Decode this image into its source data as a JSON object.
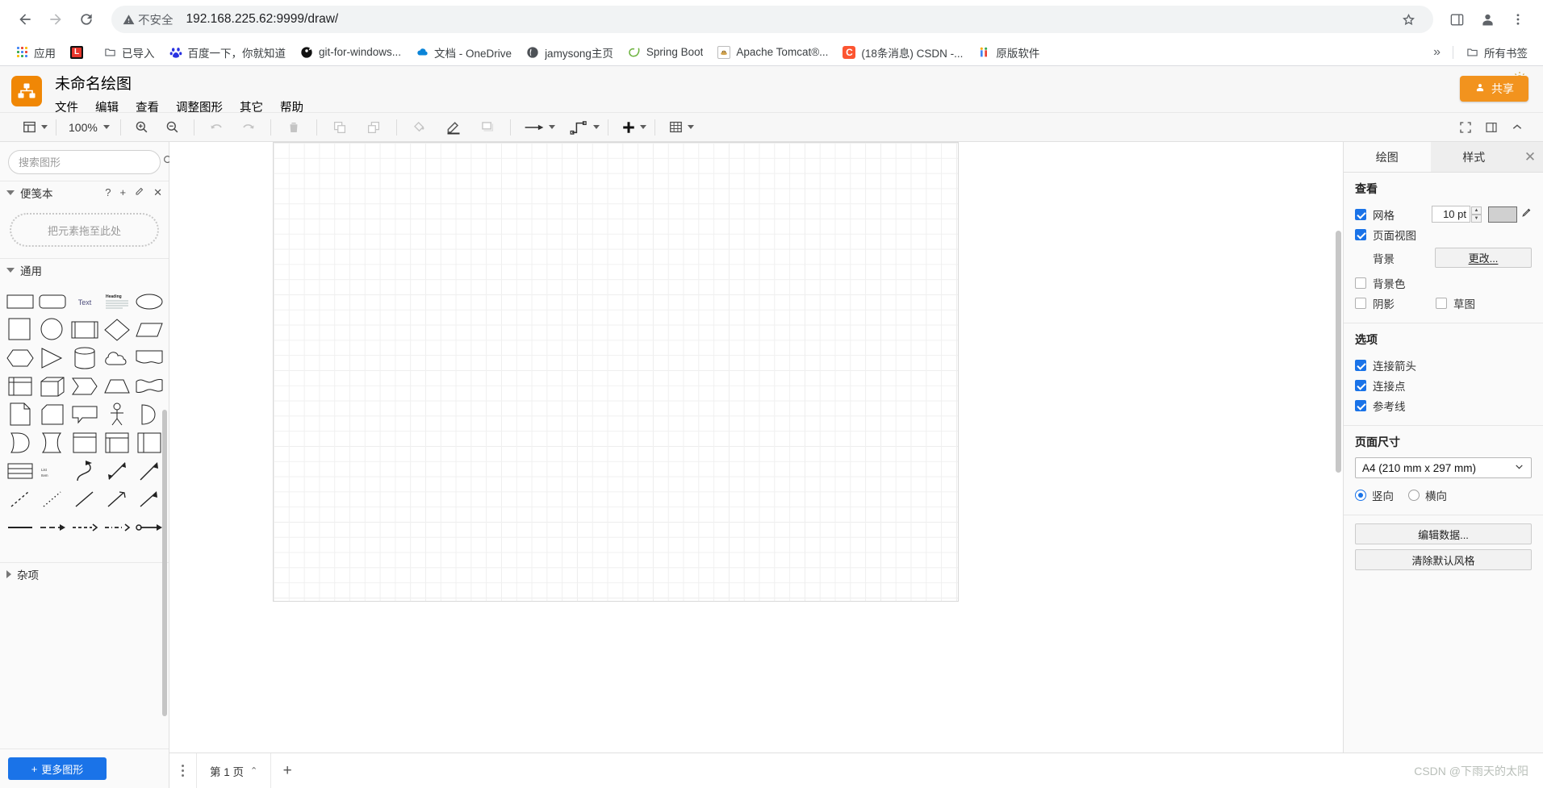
{
  "browser": {
    "back_label": "Back",
    "forward_label": "Forward",
    "reload_label": "Reload",
    "security_label": "不安全",
    "url": "192.168.225.62:9999/draw/",
    "star_label": "Bookmark",
    "sidepanel_label": "Side panel",
    "profile_label": "Profile",
    "menu_label": "Chrome menu",
    "bookmarks": [
      {
        "label": "应用",
        "icon": "apps-grid-icon",
        "color": "#4285f4"
      },
      {
        "label": "",
        "icon": "leetcode-icon",
        "color": "#ef4444"
      },
      {
        "label": "已导入",
        "icon": "folder-icon",
        "color": "#5f6368"
      },
      {
        "label": "百度一下，你就知道",
        "icon": "baidu-icon",
        "color": "#2932e1"
      },
      {
        "label": "git-for-windows...",
        "icon": "git-icon",
        "color": "#111111"
      },
      {
        "label": "文档 - OneDrive",
        "icon": "onedrive-icon",
        "color": "#0a84d8"
      },
      {
        "label": "jamysong主页",
        "icon": "globe-icon",
        "color": "#4d5156"
      },
      {
        "label": "Spring Boot",
        "icon": "spring-icon",
        "color": "#6db33f"
      },
      {
        "label": "Apache Tomcat®...",
        "icon": "tomcat-icon",
        "color": "#d1a34f"
      },
      {
        "label": "(18条消息) CSDN -...",
        "icon": "csdn-icon",
        "color": "#fc5531"
      },
      {
        "label": "原版软件",
        "icon": "people-icon",
        "color": "#f9ab00"
      }
    ],
    "overflow_label": "»",
    "all_bookmarks_label": "所有书签"
  },
  "app": {
    "logo_name": "drawio-logo",
    "title": "未命名绘图",
    "menus": [
      "文件",
      "编辑",
      "查看",
      "调整图形",
      "其它",
      "帮助"
    ],
    "share_label": "共享",
    "theme_toggle_label": "切换主题"
  },
  "toolbar": {
    "view_label": "视图",
    "zoom_value": "100%",
    "zoom_in_label": "放大",
    "zoom_out_label": "缩小",
    "undo_label": "撤销",
    "redo_label": "重做",
    "delete_label": "删除",
    "to_front_label": "置于顶层",
    "to_back_label": "置于底层",
    "fill_label": "填充颜色",
    "line_label": "线条颜色",
    "shadow_label": "阴影",
    "waypoints_label": "连线样式",
    "connection_label": "连接方式",
    "insert_label": "插入",
    "table_label": "表格",
    "fullscreen_label": "全屏",
    "format_label": "格式面板",
    "collapse_label": "折叠"
  },
  "sidebar": {
    "search": {
      "placeholder": "搜索图形",
      "value": "",
      "icon": "search-icon"
    },
    "scratchpad": {
      "title": "便笺本",
      "help_label": "?",
      "add_label": "+",
      "edit_label": "✎",
      "close_label": "✕",
      "drop_hint": "把元素拖至此处"
    },
    "general": {
      "title": "通用"
    },
    "misc": {
      "title": "杂项"
    },
    "more_shapes_label": "更多图形",
    "shapes": [
      "rectangle",
      "rounded-rectangle",
      "text",
      "textbox",
      "ellipse",
      "square",
      "circle",
      "process",
      "diamond",
      "parallelogram",
      "hexagon",
      "triangle",
      "cylinder",
      "cloud",
      "document",
      "internal-storage",
      "cube",
      "step",
      "trapezoid",
      "tape",
      "note",
      "card",
      "callout",
      "actor",
      "or",
      "and",
      "data-storage",
      "container",
      "container2",
      "vertical-container",
      "horizontal-pool",
      "list",
      "curve",
      "bidirectional-arrow",
      "arrow",
      "dashed-line",
      "dotted-line",
      "line",
      "directional-connector",
      "directional-arrow",
      "link",
      "dashed-connector",
      "dashed-arrow",
      "dash-dot-arrow",
      "bidir-connector"
    ]
  },
  "format": {
    "tabs": [
      {
        "label": "绘图",
        "active": true
      },
      {
        "label": "样式",
        "active": false
      }
    ],
    "close_label": "✕",
    "view": {
      "title": "查看",
      "grid_label": "网格",
      "grid_checked": true,
      "grid_size_value": "10 pt",
      "grid_color": "#d0d0d0",
      "page_view_label": "页面视图",
      "page_view_checked": true,
      "background_label": "背景",
      "change_label": "更改...",
      "background_color_label": "背景色",
      "background_color_checked": false,
      "shadow_label": "阴影",
      "shadow_checked": false,
      "sketch_label": "草图",
      "sketch_checked": false
    },
    "options": {
      "title": "选项",
      "items": [
        {
          "label": "连接箭头",
          "checked": true
        },
        {
          "label": "连接点",
          "checked": true
        },
        {
          "label": "参考线",
          "checked": true
        }
      ]
    },
    "paper": {
      "title": "页面尺寸",
      "size_value": "A4 (210 mm x 297 mm)",
      "portrait_label": "竖向",
      "landscape_label": "横向",
      "orientation": "portrait"
    },
    "actions": {
      "edit_data_label": "编辑数据...",
      "clear_style_label": "清除默认风格"
    }
  },
  "footer": {
    "menu_label": "页面菜单",
    "page_label": "第 1 页",
    "page_caret": "⌃",
    "add_page_label": "+",
    "watermark": "CSDN @下雨天的太阳"
  },
  "colors": {
    "accent": "#1a73e8",
    "brand_orange": "#f08705",
    "share_orange": "#f2931e",
    "panel_bg": "#fafafa",
    "chrome_bg": "#ffffff"
  }
}
